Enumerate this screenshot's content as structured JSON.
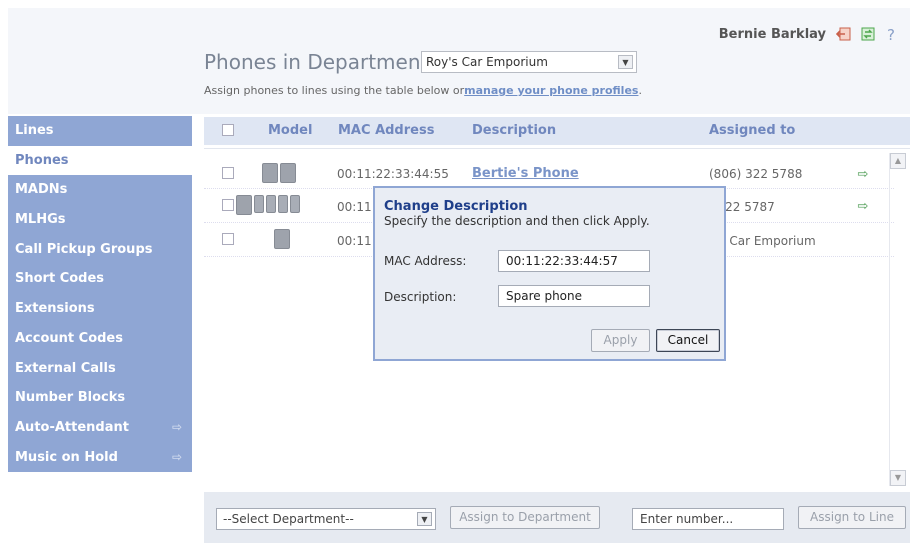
{
  "header": {
    "user_name": "Bernie Barklay",
    "icons": [
      "logout-icon",
      "refresh-icon",
      "help-icon"
    ],
    "title": "Phones in Department:",
    "department_selected": "Roy's Car Emporium",
    "subtitle_prefix": "Assign phones to lines using the table below or",
    "subtitle_link": "manage your phone profiles",
    "subtitle_suffix": "."
  },
  "sidebar": {
    "items": [
      {
        "label": "Lines"
      },
      {
        "label": "Phones"
      },
      {
        "label": "MADNs"
      },
      {
        "label": "MLHGs"
      },
      {
        "label": "Call Pickup Groups"
      },
      {
        "label": "Short Codes"
      },
      {
        "label": "Extensions"
      },
      {
        "label": "Account Codes"
      },
      {
        "label": "External Calls"
      },
      {
        "label": "Number Blocks"
      },
      {
        "label": "Auto-Attendant"
      },
      {
        "label": "Music on Hold"
      }
    ],
    "active": "Phones"
  },
  "table": {
    "headers": [
      "Model",
      "MAC Address",
      "Description",
      "Assigned to"
    ],
    "rows": [
      {
        "mac": "00:11:22:33:44:55",
        "description": "Bertie's Phone",
        "assigned": "(806) 322 5788"
      },
      {
        "mac": "00:11",
        "description": "",
        "assigned": ") 322 5787"
      },
      {
        "mac": "00:11",
        "description": "",
        "assigned": "'s Car Emporium"
      }
    ]
  },
  "dialog": {
    "title": "Change Description",
    "description": "Specify the description and then click Apply.",
    "mac_label": "MAC Address:",
    "mac_value": "00:11:22:33:44:57",
    "desc_label": "Description:",
    "desc_value": "Spare phone",
    "apply_label": "Apply",
    "cancel_label": "Cancel"
  },
  "footer": {
    "department_placeholder": "--Select Department--",
    "assign_department_label": "Assign to Department",
    "number_placeholder": "Enter number...",
    "assign_line_label": "Assign to Line"
  },
  "colors": {
    "sidebar_bg": "#8fa6d4",
    "accent": "#7087be",
    "dialog_title": "#1f3f8a",
    "header_bg": "#dfe6f3"
  }
}
